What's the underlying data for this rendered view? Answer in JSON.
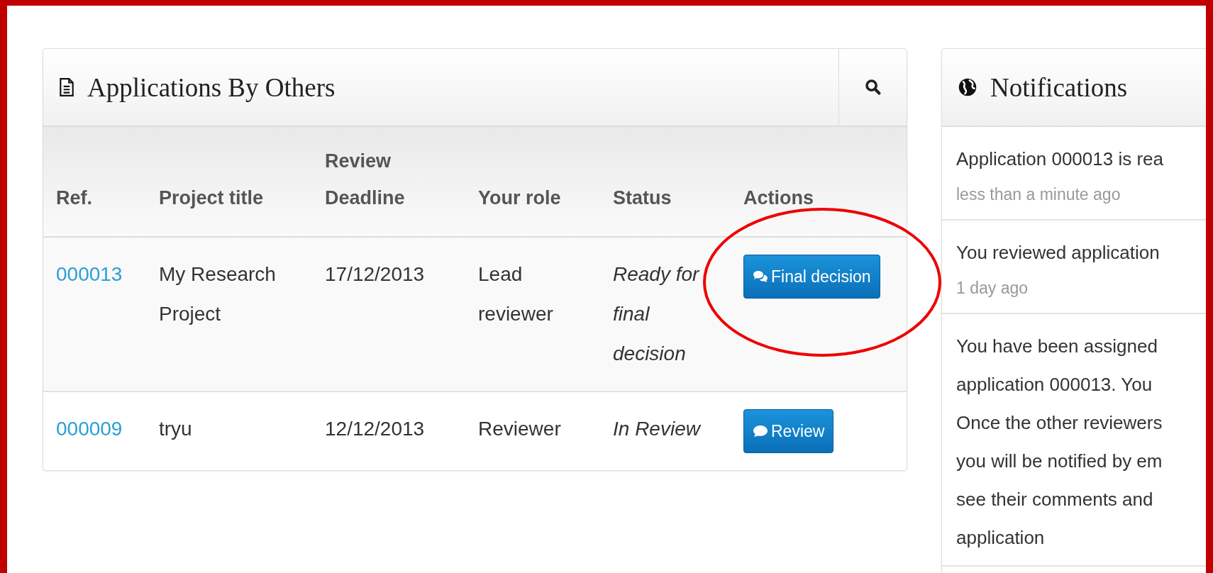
{
  "applications_panel": {
    "title": "Applications By Others",
    "table": {
      "columns": [
        "Ref.",
        "Project title",
        "Review Deadline",
        "Your role",
        "Status",
        "Actions"
      ],
      "rows": [
        {
          "ref": "000013",
          "project_title": "My Research Project",
          "deadline": "17/12/2013",
          "role": "Lead reviewer",
          "status": "Ready for final decision",
          "action": "Final decision",
          "kind": "decision"
        },
        {
          "ref": "000009",
          "project_title": "tryu",
          "deadline": "12/12/2013",
          "role": "Reviewer",
          "status": "In Review",
          "action": "Review",
          "kind": "review"
        }
      ]
    }
  },
  "annotation": {
    "kind": "ellipse"
  },
  "notifications_panel": {
    "title": "Notifications",
    "items": [
      {
        "lines": [
          "Application 000013 is rea"
        ],
        "time": "less than a minute ago"
      },
      {
        "lines": [
          "You reviewed application"
        ],
        "time": "1 day ago"
      },
      {
        "lines": [
          "You have been assigned",
          "application 000013. You",
          "Once the other reviewers",
          "you will be notified by em",
          "see their comments and",
          "application"
        ]
      }
    ]
  }
}
